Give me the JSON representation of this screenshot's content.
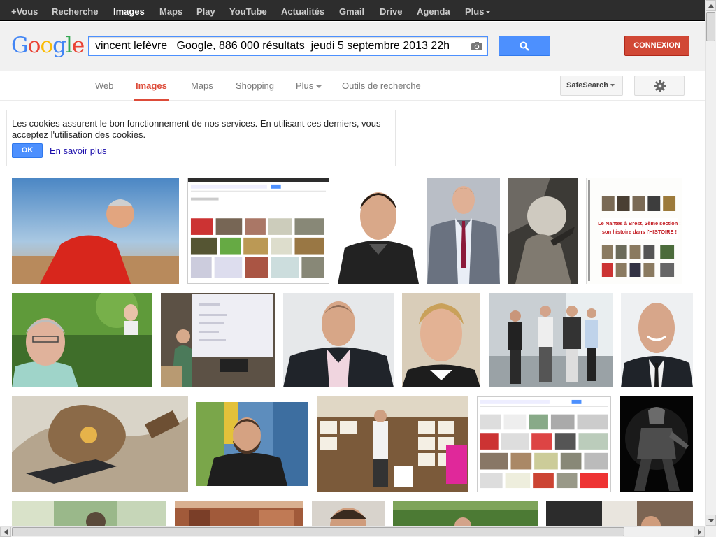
{
  "topbar": {
    "items": [
      "+Vous",
      "Recherche",
      "Images",
      "Maps",
      "Play",
      "YouTube",
      "Actualités",
      "Gmail",
      "Drive",
      "Agenda",
      "Plus"
    ],
    "active_index": 2
  },
  "header": {
    "logo_letters": [
      {
        "char": "G",
        "color": "#4285f4"
      },
      {
        "char": "o",
        "color": "#ea4335"
      },
      {
        "char": "o",
        "color": "#fbbc05"
      },
      {
        "char": "g",
        "color": "#4285f4"
      },
      {
        "char": "l",
        "color": "#34a853"
      },
      {
        "char": "e",
        "color": "#ea4335"
      }
    ],
    "search_value": "vincent lefèvre   Google, 886 000 résultats  jeudi 5 septembre 2013 22h",
    "camera_icon": "camera-icon",
    "search_icon": "magnifier-icon",
    "signin_label": "CONNEXION"
  },
  "tabs": {
    "items": [
      "Web",
      "Images",
      "Maps",
      "Shopping",
      "Plus",
      "Outils de recherche"
    ],
    "active_index": 1,
    "safesearch_label": "SafeSearch",
    "settings_icon": "gear-icon"
  },
  "cookie": {
    "text": "Les cookies assurent le bon fonctionnement de nos services. En utilisant ces derniers, vous acceptez l'utilisation des cookies.",
    "ok_label": "OK",
    "more_label": "En savoir plus"
  },
  "colors": {
    "accent_blue": "#4d90fe",
    "signin_red": "#d14836",
    "active_tab_red": "#dd4b39",
    "topbar_bg": "#2d2d2d"
  }
}
